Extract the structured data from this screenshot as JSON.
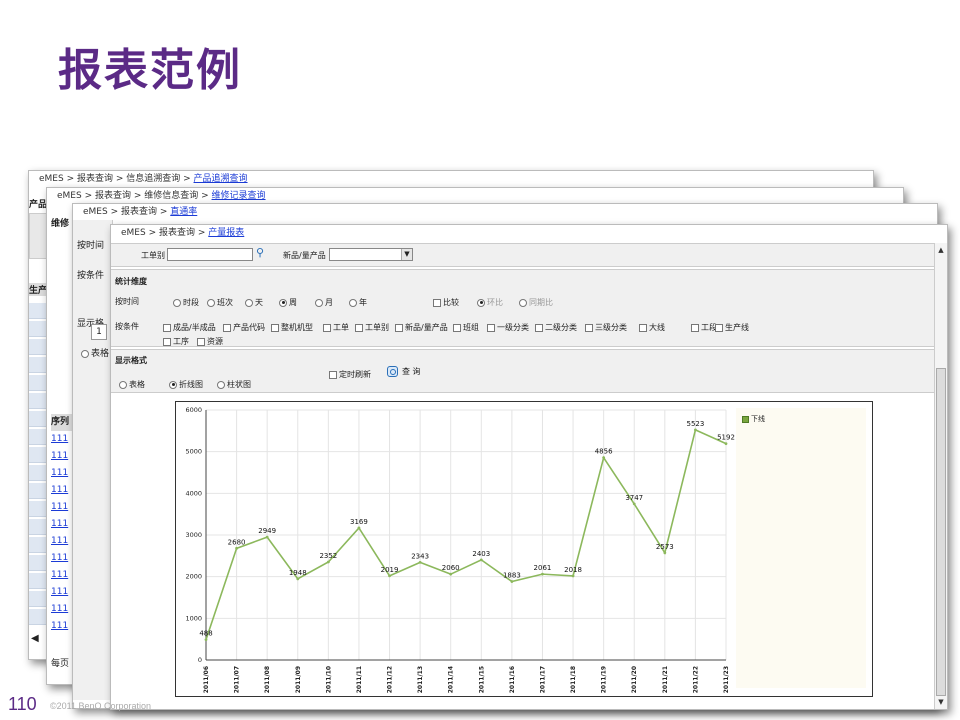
{
  "slide": {
    "title": "报表范例",
    "page_number": "110",
    "copyright": "©2011 BenQ Corporation"
  },
  "win1": {
    "crumb_root": "eMES",
    "crumb_mid1": "报表查询",
    "crumb_mid2": "信息追溯查询",
    "crumb_link": "产品追溯查询",
    "side_label": "产品",
    "col_label": "生产"
  },
  "win2": {
    "crumb_root": "eMES",
    "crumb_mid1": "报表查询",
    "crumb_mid2": "维修信息查询",
    "crumb_link": "维修记录查询",
    "side_label": "维修",
    "table_header": "序列",
    "row_value": "111",
    "footer": "每页"
  },
  "win3": {
    "crumb_root": "eMES",
    "crumb_mid1": "报表查询",
    "crumb_link": "直通率",
    "t_time": "按时间",
    "t_cond": "按条件",
    "t_show": "显示格",
    "page": "1",
    "t_table": "表格"
  },
  "main": {
    "crumb_root": "eMES",
    "crumb_mid1": "报表查询",
    "crumb_link": "产量报表",
    "filter": {
      "workorder_label": "工单别",
      "workorder_value": "",
      "product_label": "新品/量产品",
      "product_value": ""
    },
    "dims": {
      "title": "统计维度",
      "time_label": "按时间",
      "time_options": [
        "时段",
        "班次",
        "天",
        "周",
        "月",
        "年"
      ],
      "time_selected": "周",
      "compare_label": "比较",
      "compare_options": [
        "环比",
        "同期比"
      ],
      "compare_selected": "环比",
      "cond_label": "按条件",
      "cond_options_row1": [
        "成品/半成品",
        "产品代码",
        "整机机型",
        "工单",
        "工单别",
        "新品/量产品",
        "班组",
        "一级分类",
        "二级分类",
        "三级分类",
        "大线",
        "工段",
        "生产线"
      ],
      "cond_options_row2": [
        "工序",
        "资源"
      ]
    },
    "display": {
      "title": "显示格式",
      "options": [
        "表格",
        "折线图",
        "柱状图"
      ],
      "selected": "折线图",
      "refresh_label": "定时刷新",
      "query_label": "查 询"
    }
  },
  "chart_data": {
    "type": "line",
    "title": "",
    "xlabel": "",
    "ylabel": "",
    "ylim": [
      0,
      6000
    ],
    "yticks": [
      0,
      1000,
      2000,
      3000,
      4000,
      5000,
      6000
    ],
    "grid": true,
    "legend": "right",
    "color": "#8cb85c",
    "categories": [
      "2011/06",
      "2011/07",
      "2011/08",
      "2011/09",
      "2011/10",
      "2011/11",
      "2011/12",
      "2011/13",
      "2011/14",
      "2011/15",
      "2011/16",
      "2011/17",
      "2011/18",
      "2011/19",
      "2011/20",
      "2011/21",
      "2011/22",
      "2011/23"
    ],
    "series": [
      {
        "name": "下线",
        "values": [
          488,
          2680,
          2949,
          1948,
          2352,
          3169,
          2019,
          2343,
          2060,
          2403,
          1883,
          2061,
          2018,
          4856,
          3747,
          2573,
          5523,
          5192
        ]
      }
    ]
  }
}
